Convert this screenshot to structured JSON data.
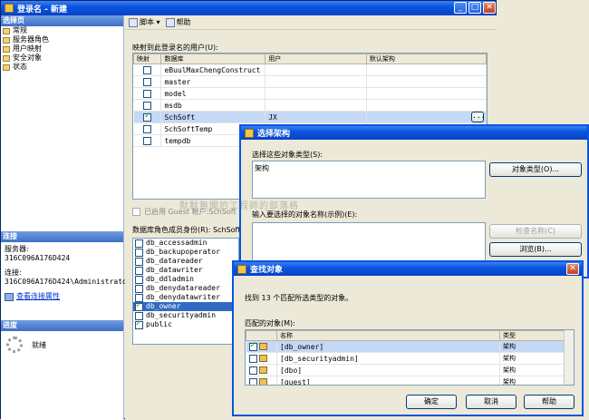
{
  "main_window": {
    "title": "登录名 - 新建",
    "left": {
      "select_page_header": "选择页",
      "pages": [
        "常规",
        "服务器角色",
        "用户映射",
        "安全对象",
        "状态"
      ],
      "connection_header": "连接",
      "server_label": "服务器:",
      "server_value": "316C096A176D424",
      "conn_label": "连接:",
      "conn_value": "316C096A176D424\\Administrator",
      "view_conn_props": "查看连接属性",
      "progress_header": "进度",
      "progress_status": "就绪"
    },
    "toolbar": {
      "script_label": "脚本",
      "help_label": "帮助"
    },
    "mapping_label": "映射到此登录名的用户(U):",
    "mapping_columns": [
      "映射",
      "数据库",
      "用户",
      "默认架构"
    ],
    "mapping_rows": [
      {
        "checked": false,
        "db": "eBuulMaxChengConstruct",
        "user": "",
        "schema": ""
      },
      {
        "checked": false,
        "db": "master",
        "user": "",
        "schema": ""
      },
      {
        "checked": false,
        "db": "model",
        "user": "",
        "schema": ""
      },
      {
        "checked": false,
        "db": "msdb",
        "user": "",
        "schema": ""
      },
      {
        "checked": true,
        "db": "SchSoft",
        "user": "JX",
        "schema": ""
      },
      {
        "checked": false,
        "db": "SchSoftTemp",
        "user": "",
        "schema": ""
      },
      {
        "checked": false,
        "db": "tempdb",
        "user": "",
        "schema": ""
      }
    ],
    "guest_label": "已启用 Guest 帐户:SchSoft",
    "roles_label": "数据库角色成员身份(R): SchSoft",
    "roles": [
      {
        "name": "db_accessadmin",
        "checked": false
      },
      {
        "name": "db_backupoperator",
        "checked": false
      },
      {
        "name": "db_datareader",
        "checked": false
      },
      {
        "name": "db_datawriter",
        "checked": false
      },
      {
        "name": "db_ddladmin",
        "checked": false
      },
      {
        "name": "db_denydatareader",
        "checked": false
      },
      {
        "name": "db_denydatawriter",
        "checked": false
      },
      {
        "name": "db_owner",
        "checked": true
      },
      {
        "name": "db_securityadmin",
        "checked": false
      },
      {
        "name": "public",
        "checked": true
      }
    ]
  },
  "select_schema_dialog": {
    "title": "选择架构",
    "type_label": "选择这些对象类型(S):",
    "type_value": "架构",
    "object_types_btn": "对象类型(O)...",
    "names_label": "输入要选择的对象名称(示例)(E):",
    "check_names_btn": "检查名称(C)",
    "browse_btn": "浏览(B)..."
  },
  "find_objects_dialog": {
    "title": "查找对象",
    "found_text": "找到 13 个匹配所选类型的对象。",
    "matching_label": "匹配的对象(M):",
    "columns": [
      "名称",
      "类型"
    ],
    "rows": [
      {
        "checked": true,
        "name": "[db_owner]",
        "type": "架构"
      },
      {
        "checked": false,
        "name": "[db_securityadmin]",
        "type": "架构"
      },
      {
        "checked": false,
        "name": "[dbo]",
        "type": "架构"
      },
      {
        "checked": false,
        "name": "[guest]",
        "type": "架构"
      }
    ],
    "ok_btn": "确定",
    "cancel_btn": "取消",
    "help_btn": "帮助"
  },
  "watermark": "默默無聞的工程師的部落格",
  "colors": {
    "title_blue": "#0a55df",
    "selection": "#316ac5",
    "window_bg": "#ece9d8"
  }
}
